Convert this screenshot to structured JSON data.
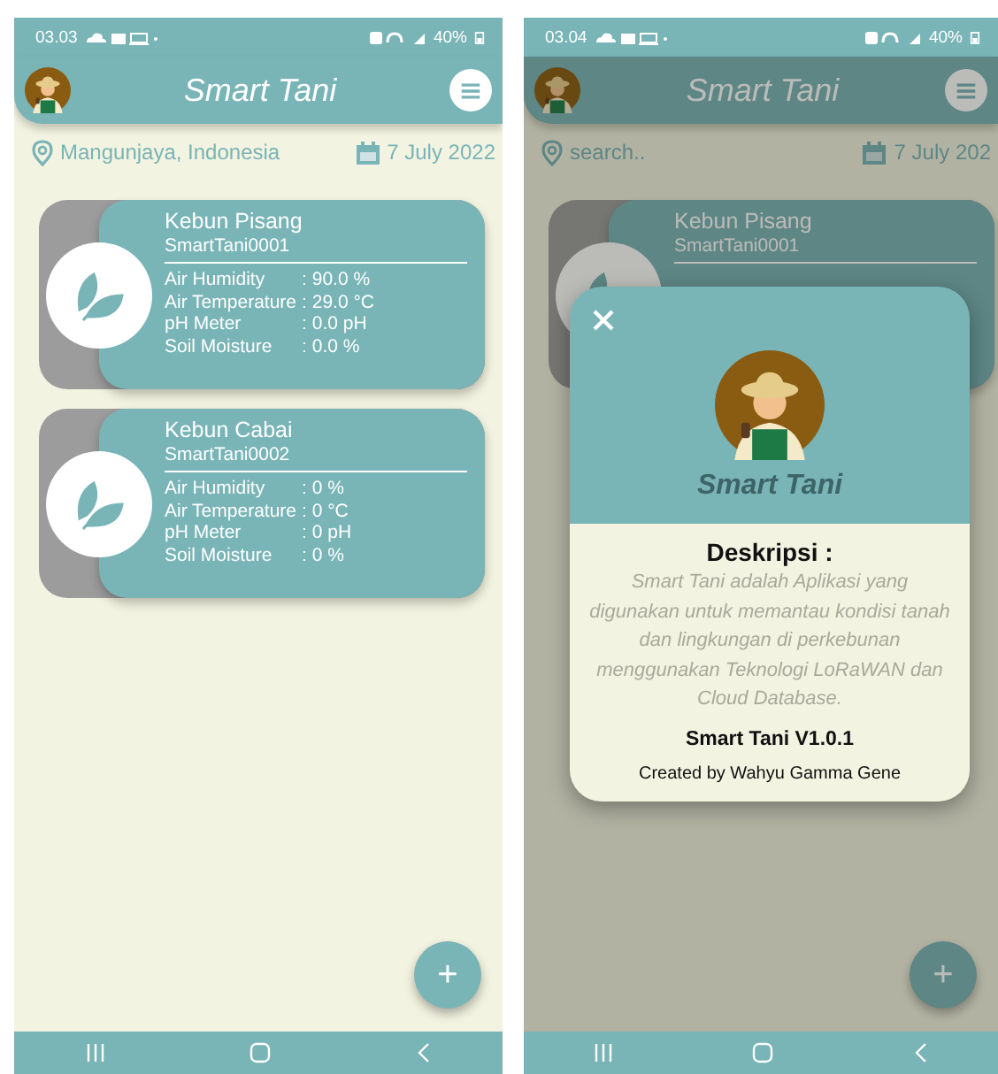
{
  "screens": [
    {
      "status_bar": {
        "time": "03.03",
        "battery": "40%"
      },
      "app_bar": {
        "title": "Smart Tani"
      },
      "location": {
        "value": "Mangunjaya, Indonesia"
      },
      "date": "7 July 2022",
      "dimmed": false,
      "devices": [
        {
          "name": "Kebun Pisang",
          "device_id": "SmartTani0001",
          "readings": [
            {
              "label": "Air Humidity",
              "value": ": 90.0 %"
            },
            {
              "label": "Air Temperature",
              "value": ": 29.0 °C"
            },
            {
              "label": "pH Meter",
              "value": ": 0.0 pH"
            },
            {
              "label": "Soil Moisture",
              "value": ": 0.0 %"
            }
          ]
        },
        {
          "name": "Kebun Cabai",
          "device_id": "SmartTani0002",
          "readings": [
            {
              "label": "Air Humidity",
              "value": ": 0 %"
            },
            {
              "label": "Air Temperature",
              "value": ": 0 °C"
            },
            {
              "label": "pH Meter",
              "value": ": 0 pH"
            },
            {
              "label": "Soil Moisture",
              "value": ": 0 %"
            }
          ]
        }
      ],
      "fab": "+"
    },
    {
      "status_bar": {
        "time": "03.04",
        "battery": "40%"
      },
      "app_bar": {
        "title": "Smart Tani"
      },
      "location": {
        "placeholder": "search.."
      },
      "date": "7 July 202",
      "dimmed": true,
      "devices": [
        {
          "name": "Kebun Pisang",
          "device_id": "SmartTani0001"
        }
      ],
      "fab": "+",
      "dialog": {
        "title": "Smart Tani",
        "heading": "Deskripsi :",
        "description": "Smart Tani adalah Aplikasi yang digunakan untuk memantau kondisi tanah dan lingkungan di perkebunan menggunakan Teknologi LoRaWAN dan Cloud Database.",
        "version": "Smart Tani V1.0.1",
        "credit": "Created by Wahyu Gamma Gene"
      }
    }
  ]
}
